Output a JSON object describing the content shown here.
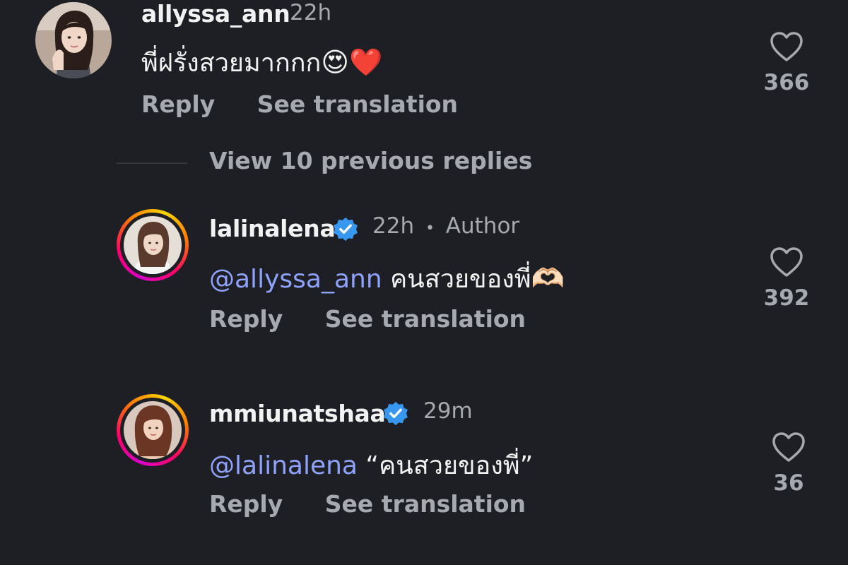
{
  "comments": [
    {
      "username": "allyssa_ann",
      "time": "22h",
      "text": "พี่ฝรั่งสวยมากกก",
      "emoji": "😍❤️",
      "reply_label": "Reply",
      "translate_label": "See translation",
      "likes": "366",
      "verified": false
    },
    {
      "username": "lalinalena",
      "time": "22h",
      "separator": "•",
      "badge": "Author",
      "mention": "@allyssa_ann",
      "text": " คนสวยของพี่",
      "emoji": "🫶🏻",
      "reply_label": "Reply",
      "translate_label": "See translation",
      "likes": "392",
      "verified": true
    },
    {
      "username": "mmiunatshaa",
      "time": "29m",
      "mention": "@lalinalena",
      "text": " “คนสวยของพี่”",
      "reply_label": "Reply",
      "translate_label": "See translation",
      "likes": "36",
      "verified": true
    }
  ],
  "view_replies_label": "View 10 previous replies",
  "colors": {
    "background": "#1d1f24",
    "text": "#f2f2f3",
    "muted": "#a7a9b0",
    "mention": "#8fa2ff",
    "verified": "#3897f0"
  },
  "icons": {
    "like": "heart-outline-icon",
    "verified": "verified-badge-icon"
  }
}
